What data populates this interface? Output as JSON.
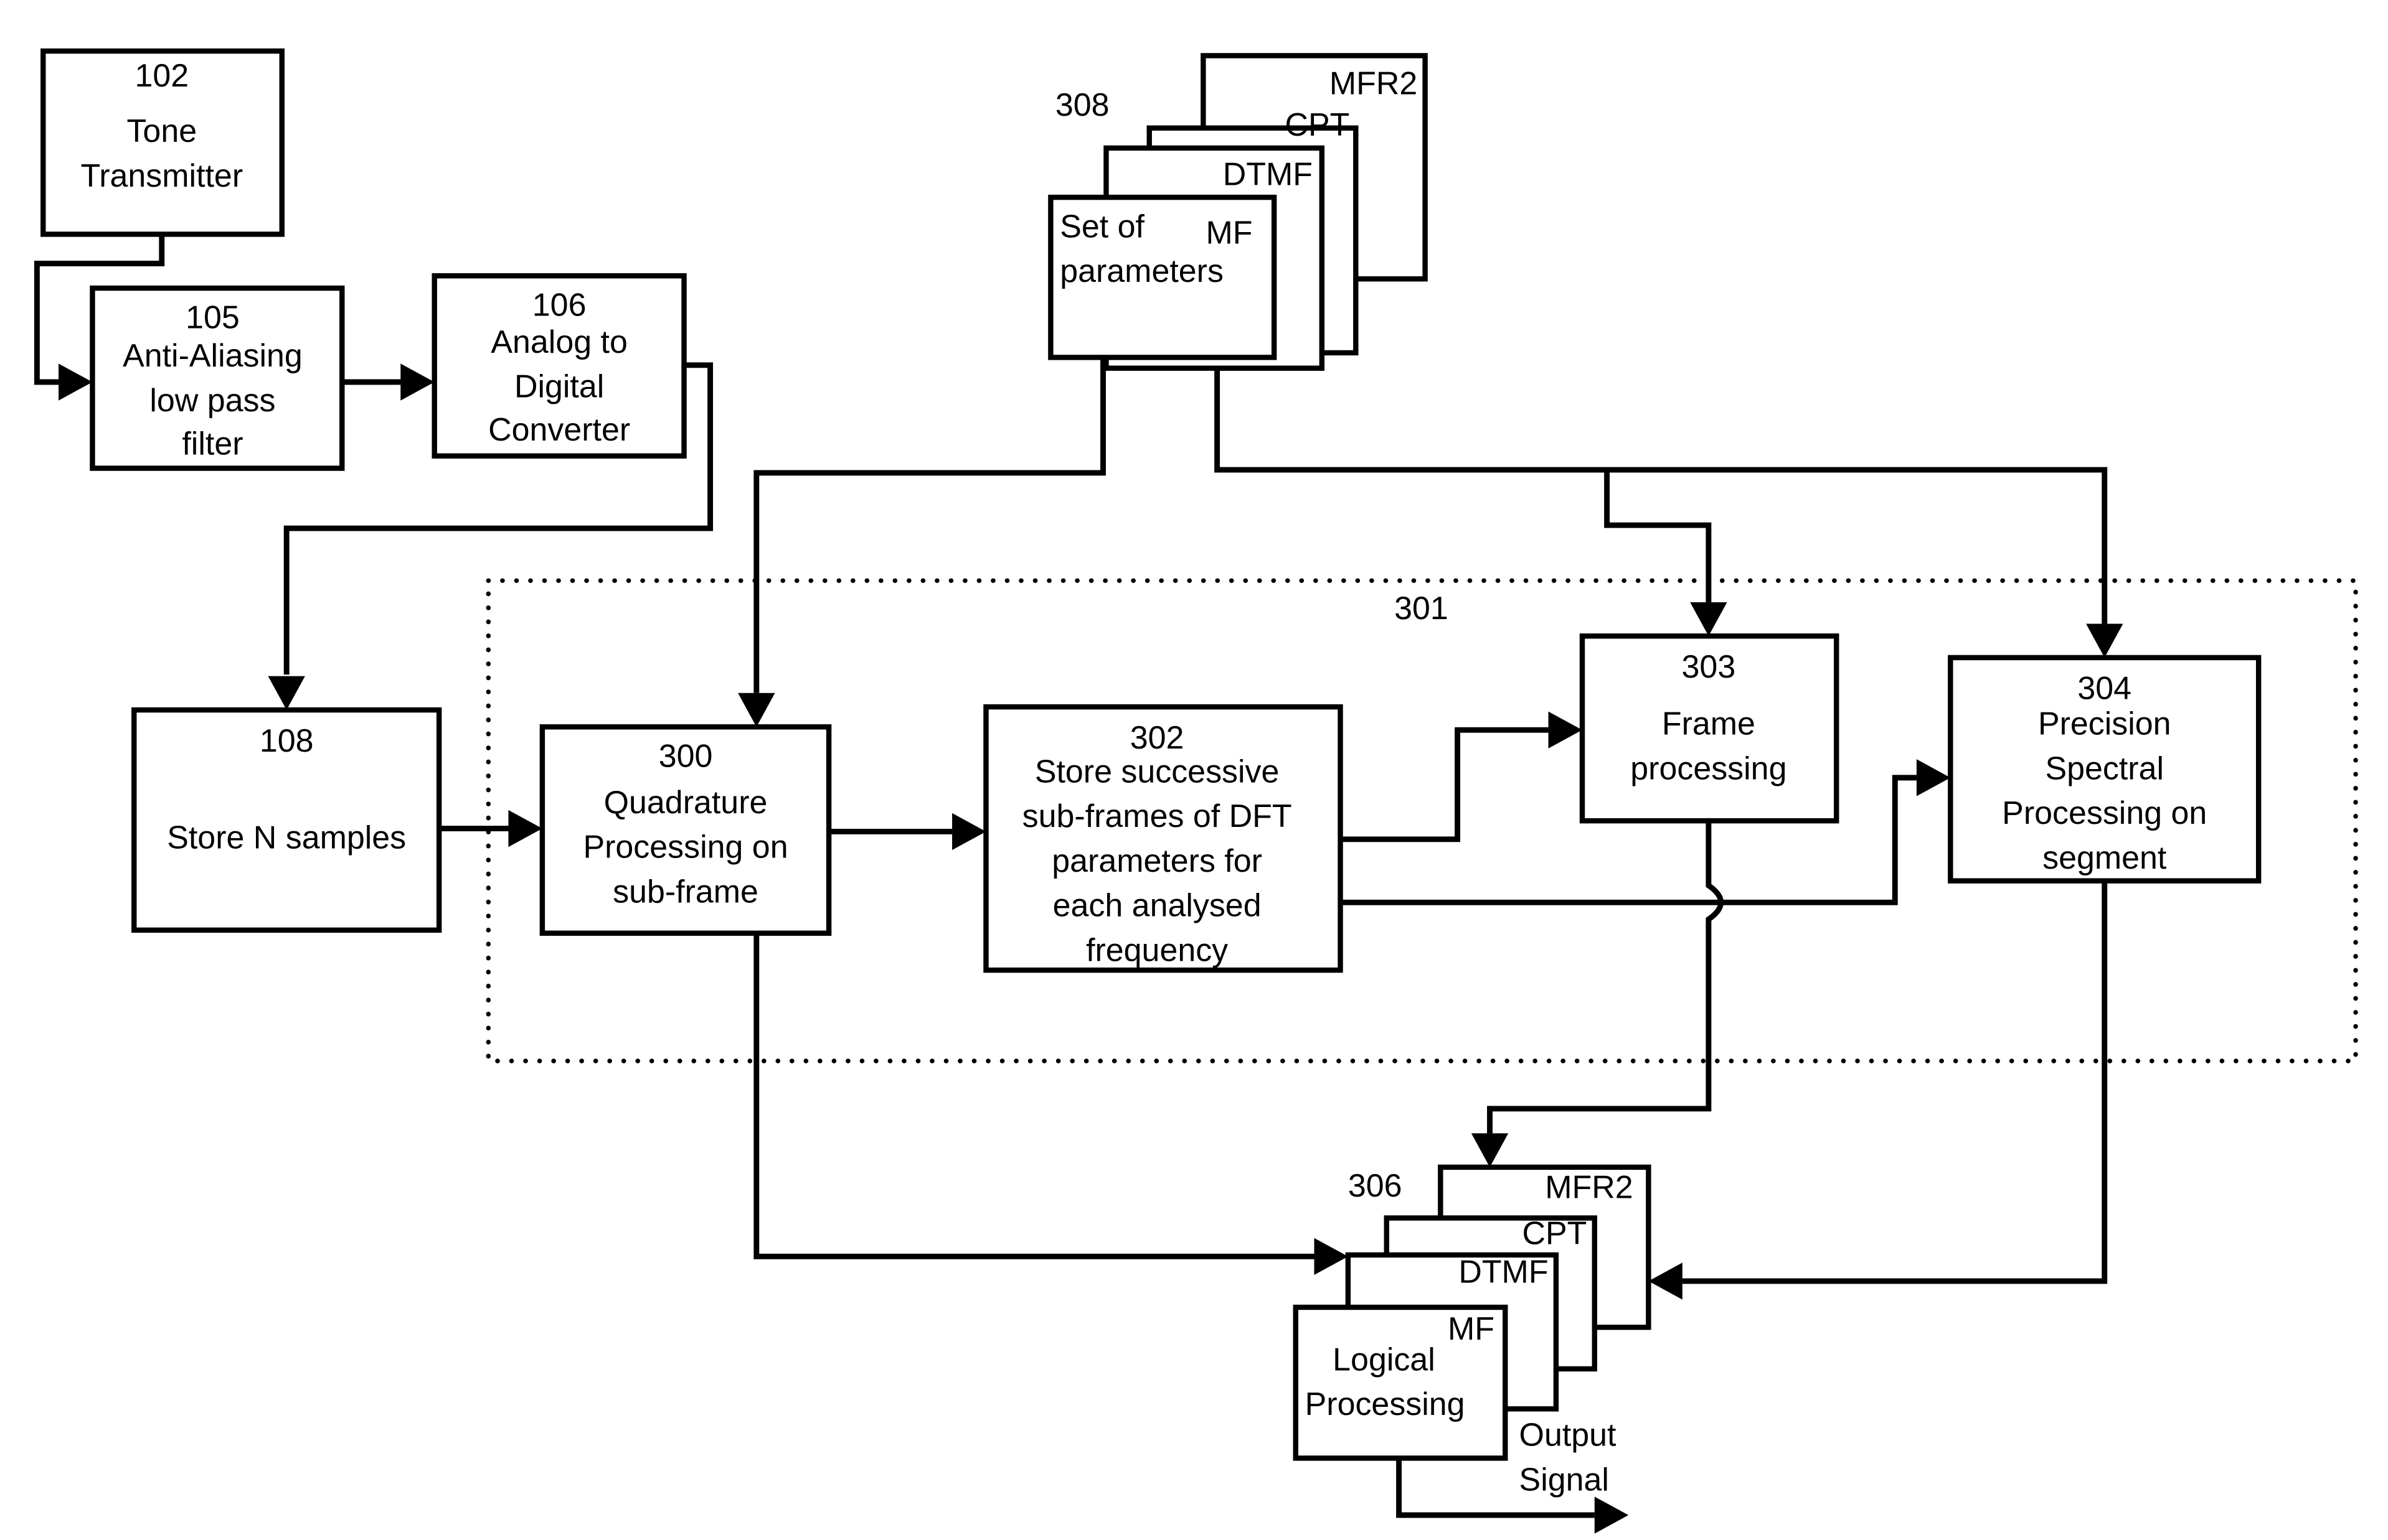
{
  "diagram": {
    "blocks": {
      "b102": {
        "number": "102",
        "lines": [
          "Tone",
          "Transmitter"
        ]
      },
      "b105": {
        "number": "105",
        "lines": [
          "Anti-Aliasing",
          "low pass",
          "filter"
        ]
      },
      "b106": {
        "number": "106",
        "lines": [
          "Analog to",
          "Digital",
          "Converter"
        ]
      },
      "b108": {
        "number": "108",
        "lines": [
          "Store N samples"
        ]
      },
      "b300": {
        "number": "300",
        "lines": [
          "Quadrature",
          "Processing on",
          "sub-frame"
        ]
      },
      "b302": {
        "number": "302",
        "lines": [
          "Store successive",
          "sub-frames of DFT",
          "parameters for",
          "each analysed",
          "frequency"
        ]
      },
      "b303": {
        "number": "303",
        "lines": [
          "Frame",
          "processing"
        ]
      },
      "b304": {
        "number": "304",
        "lines": [
          "Precision",
          "Spectral",
          "Processing on",
          "segment"
        ]
      }
    },
    "group301": {
      "number": "301"
    },
    "stack308": {
      "number": "308",
      "cards": [
        "MFR2",
        "CPT",
        "DTMF",
        "MF"
      ],
      "front_lines": [
        "Set of",
        "parameters"
      ]
    },
    "stack306": {
      "number": "306",
      "cards": [
        "MFR2",
        "CPT",
        "DTMF",
        "MF"
      ],
      "front_lines": [
        "Logical",
        "Processing"
      ]
    },
    "output_label": [
      "Output",
      "Signal"
    ]
  }
}
